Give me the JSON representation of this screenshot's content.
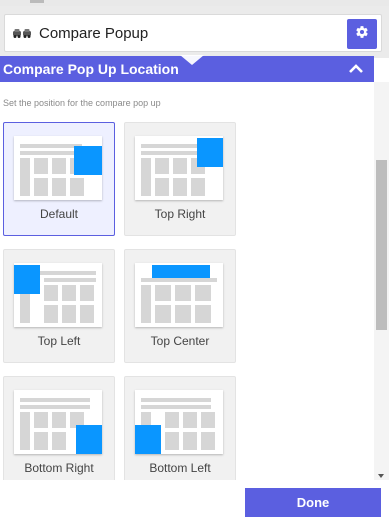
{
  "header": {
    "title": "Compare Popup",
    "app_icon": "compare-cars-icon",
    "settings_icon": "gear-icon"
  },
  "section": {
    "title": "Compare Pop Up Location",
    "collapse_icon": "chevron-up-icon",
    "help_text": "Set the position for the compare pop up"
  },
  "options": [
    {
      "label": "Default",
      "selected": true
    },
    {
      "label": "Top Right",
      "selected": false
    },
    {
      "label": "Top Left",
      "selected": false
    },
    {
      "label": "Top Center",
      "selected": false
    },
    {
      "label": "Bottom Right",
      "selected": false
    },
    {
      "label": "Bottom Left",
      "selected": false
    }
  ],
  "footer": {
    "done_label": "Done"
  },
  "colors": {
    "accent": "#5b5fe0",
    "popup_block": "#0a96ff",
    "wire": "#d6d6d6"
  }
}
